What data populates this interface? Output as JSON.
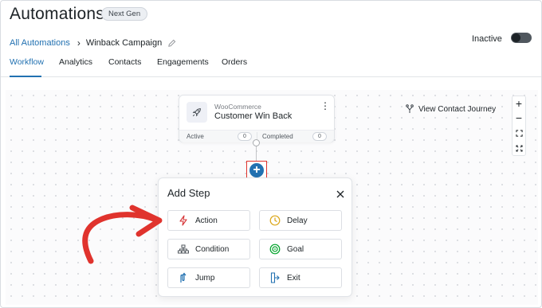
{
  "header": {
    "title": "Automations",
    "badge": "Next Gen"
  },
  "breadcrumb": {
    "root": "All Automations",
    "current": "Winback Campaign"
  },
  "status": {
    "label": "Inactive",
    "enabled": false
  },
  "tabs": [
    {
      "label": "Workflow",
      "active": true
    },
    {
      "label": "Analytics",
      "active": false
    },
    {
      "label": "Contacts",
      "active": false
    },
    {
      "label": "Engagements",
      "active": false
    },
    {
      "label": "Orders",
      "active": false
    }
  ],
  "trigger_node": {
    "source": "WooCommerce",
    "title": "Customer Win Back",
    "active_label": "Active",
    "active_count": "0",
    "completed_label": "Completed",
    "completed_count": "0"
  },
  "journey_link": "View Contact Journey",
  "zoom_controls": [
    "+",
    "−",
    "fit",
    "fullscreen"
  ],
  "add_step": {
    "title": "Add Step",
    "steps": [
      {
        "label": "Action",
        "icon": "lightning-icon",
        "color": "#d63638"
      },
      {
        "label": "Delay",
        "icon": "clock-icon",
        "color": "#dba617"
      },
      {
        "label": "Condition",
        "icon": "hierarchy-icon",
        "color": "#50575e"
      },
      {
        "label": "Goal",
        "icon": "target-icon",
        "color": "#00a32a"
      },
      {
        "label": "Jump",
        "icon": "jump-icon",
        "color": "#2271b1"
      },
      {
        "label": "Exit",
        "icon": "exit-icon",
        "color": "#2271b1"
      }
    ]
  },
  "colors": {
    "accent": "#2271b1",
    "highlight": "#e0332d"
  }
}
